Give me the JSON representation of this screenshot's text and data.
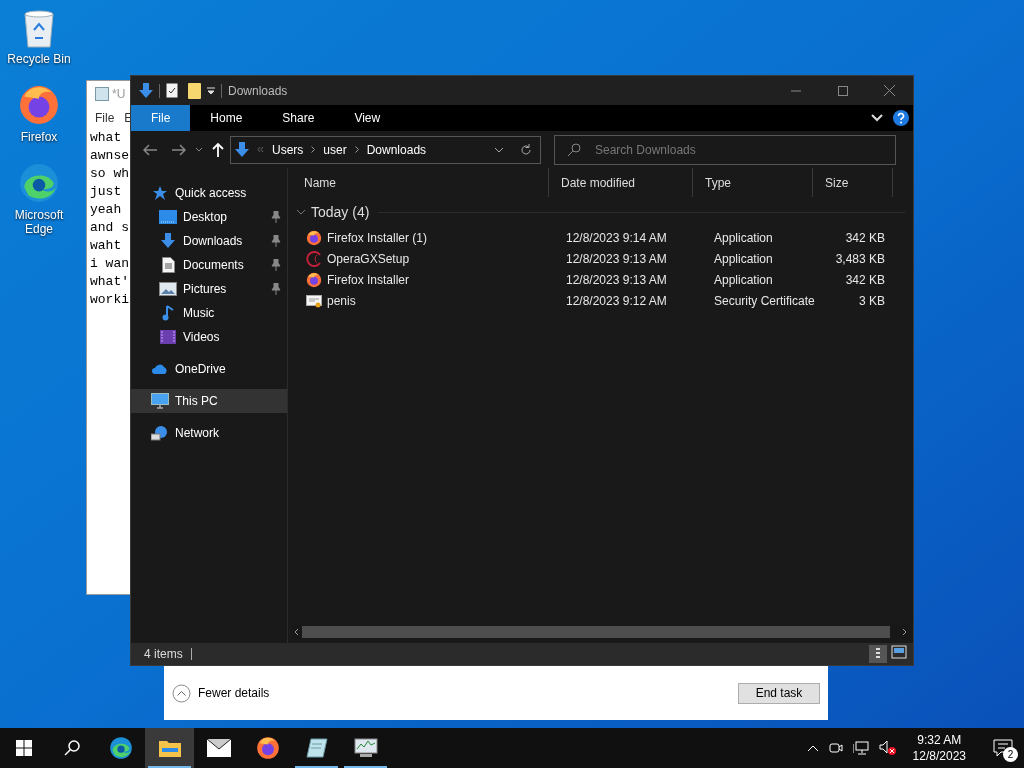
{
  "desktop_icons": [
    {
      "kind": "recycle",
      "label": "Recycle Bin"
    },
    {
      "kind": "firefox",
      "label": "Firefox"
    },
    {
      "kind": "edge",
      "label": "Microsoft Edge"
    }
  ],
  "notepad": {
    "title": "*U",
    "menu": [
      "File",
      "E"
    ],
    "lines": [
      "what",
      "awnse",
      "so wh",
      "just",
      "yeah",
      "and s",
      "waht",
      "i wan",
      "what'",
      "worki"
    ]
  },
  "task_manager": {
    "fewer_details": "Fewer details",
    "end_task": "End task"
  },
  "explorer": {
    "title": "Downloads",
    "ribbon_tabs": [
      {
        "label": "File",
        "selected": true
      },
      {
        "label": "Home",
        "selected": false
      },
      {
        "label": "Share",
        "selected": false
      },
      {
        "label": "View",
        "selected": false
      }
    ],
    "breadcrumb": [
      "Users",
      "user",
      "Downloads"
    ],
    "search": {
      "placeholder": "Search Downloads"
    },
    "nav": [
      {
        "kind": "star",
        "label": "Quick access",
        "selected": false,
        "children": [
          {
            "kind": "desktop",
            "label": "Desktop",
            "pinned": true,
            "selected": false
          },
          {
            "kind": "download",
            "label": "Downloads",
            "pinned": true,
            "selected": false
          },
          {
            "kind": "document",
            "label": "Documents",
            "pinned": true,
            "selected": false
          },
          {
            "kind": "pictures",
            "label": "Pictures",
            "pinned": true,
            "selected": false
          },
          {
            "kind": "music",
            "label": "Music",
            "pinned": false,
            "selected": false
          },
          {
            "kind": "videos",
            "label": "Videos",
            "pinned": false,
            "selected": false
          }
        ]
      },
      {
        "kind": "cloud",
        "label": "OneDrive",
        "selected": false
      },
      {
        "kind": "pc",
        "label": "This PC",
        "selected": true
      },
      {
        "kind": "network",
        "label": "Network",
        "selected": false
      }
    ],
    "columns": [
      "Name",
      "Date modified",
      "Type",
      "Size"
    ],
    "group": "Today (4)",
    "files": [
      {
        "kind": "firefox",
        "name": "Firefox Installer (1)",
        "date": "12/8/2023 9:14 AM",
        "type": "Application",
        "size": "342 KB"
      },
      {
        "kind": "opera",
        "name": "OperaGXSetup",
        "date": "12/8/2023 9:13 AM",
        "type": "Application",
        "size": "3,483 KB"
      },
      {
        "kind": "firefox",
        "name": "Firefox Installer",
        "date": "12/8/2023 9:13 AM",
        "type": "Application",
        "size": "342 KB"
      },
      {
        "kind": "certificate",
        "name": "penis",
        "date": "12/8/2023 9:12 AM",
        "type": "Security Certificate",
        "size": "3 KB"
      }
    ],
    "status": "4 items"
  },
  "taskbar": {
    "apps": [
      {
        "kind": "edge",
        "running": false,
        "active": false
      },
      {
        "kind": "explorer",
        "running": true,
        "active": true
      },
      {
        "kind": "mail",
        "running": false,
        "active": false
      },
      {
        "kind": "firefox",
        "running": false,
        "active": false
      },
      {
        "kind": "notepad",
        "running": true,
        "active": false
      },
      {
        "kind": "taskmgr",
        "running": true,
        "active": false
      }
    ],
    "time": "9:32 AM",
    "date": "12/8/2023",
    "notifications": "2"
  }
}
